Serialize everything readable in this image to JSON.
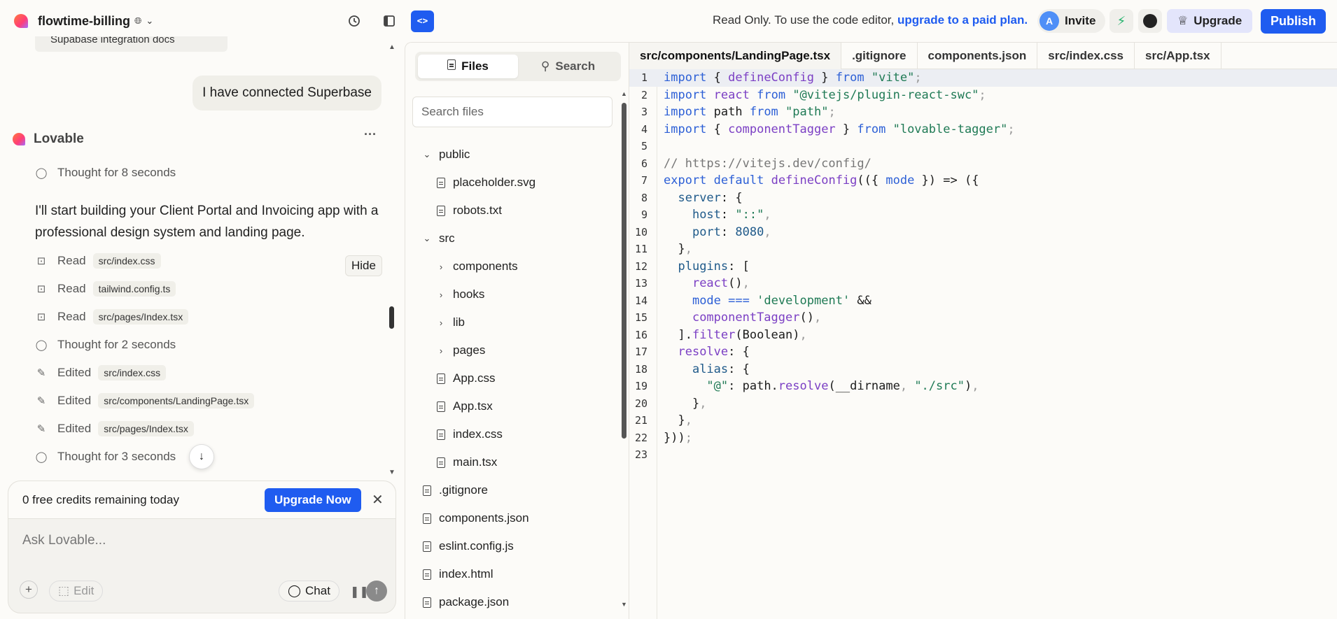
{
  "topbar": {
    "project_name": "flowtime-billing",
    "readonly_prefix": "Read Only. To use the code editor,",
    "readonly_link": "upgrade to a paid plan.",
    "avatar_letter": "A",
    "invite_label": "Invite",
    "upgrade_label": "Upgrade",
    "publish_label": "Publish",
    "code_toggle_label": "<>"
  },
  "chat": {
    "partial_chip": "Supabase integration docs",
    "user_message": "I have connected Superbase",
    "agent_name": "Lovable",
    "thought_1": "Thought for 8 seconds",
    "agent_text": "I'll start building your Client Portal and Invoicing app with a professional design system and landing page.",
    "hide_label": "Hide",
    "steps": [
      {
        "icon": "read-icon",
        "verb": "Read",
        "file": "src/index.css"
      },
      {
        "icon": "read-icon",
        "verb": "Read",
        "file": "tailwind.config.ts"
      },
      {
        "icon": "read-icon",
        "verb": "Read",
        "file": "src/pages/Index.tsx"
      },
      {
        "icon": "thought-icon",
        "verb": "Thought for 2 seconds",
        "file": ""
      },
      {
        "icon": "edit-icon",
        "verb": "Edited",
        "file": "src/index.css"
      },
      {
        "icon": "edit-icon",
        "verb": "Edited",
        "file": "src/components/LandingPage.tsx"
      },
      {
        "icon": "edit-icon",
        "verb": "Edited",
        "file": "src/pages/Index.tsx"
      },
      {
        "icon": "thought-icon",
        "verb": "Thought for 3 seconds",
        "file": ""
      }
    ],
    "credits_text": "0 free credits remaining today",
    "upgrade_now_label": "Upgrade Now",
    "input_placeholder": "Ask Lovable...",
    "edit_label": "Edit",
    "chat_label": "Chat"
  },
  "files": {
    "tab_files": "Files",
    "tab_search": "Search",
    "search_placeholder": "Search files",
    "tree": [
      {
        "name": "public",
        "type": "folder-open",
        "depth": 0
      },
      {
        "name": "placeholder.svg",
        "type": "file",
        "depth": 1
      },
      {
        "name": "robots.txt",
        "type": "file",
        "depth": 1
      },
      {
        "name": "src",
        "type": "folder-open",
        "depth": 0
      },
      {
        "name": "components",
        "type": "folder",
        "depth": 1
      },
      {
        "name": "hooks",
        "type": "folder",
        "depth": 1
      },
      {
        "name": "lib",
        "type": "folder",
        "depth": 1
      },
      {
        "name": "pages",
        "type": "folder",
        "depth": 1
      },
      {
        "name": "App.css",
        "type": "file",
        "depth": 1
      },
      {
        "name": "App.tsx",
        "type": "file",
        "depth": 1
      },
      {
        "name": "index.css",
        "type": "file",
        "depth": 1
      },
      {
        "name": "main.tsx",
        "type": "file",
        "depth": 1
      },
      {
        "name": ".gitignore",
        "type": "file",
        "depth": 0
      },
      {
        "name": "components.json",
        "type": "file",
        "depth": 0
      },
      {
        "name": "eslint.config.js",
        "type": "file",
        "depth": 0
      },
      {
        "name": "index.html",
        "type": "file",
        "depth": 0
      },
      {
        "name": "package.json",
        "type": "file",
        "depth": 0
      }
    ]
  },
  "editor": {
    "tabs": [
      "src/components/LandingPage.tsx",
      ".gitignore",
      "components.json",
      "src/index.css",
      "src/App.tsx"
    ],
    "active_tab": 0,
    "lines": [
      "import { defineConfig } from \"vite\";",
      "import react from \"@vitejs/plugin-react-swc\";",
      "import path from \"path\";",
      "import { componentTagger } from \"lovable-tagger\";",
      "",
      "// https://vitejs.dev/config/",
      "export default defineConfig(({ mode }) => ({",
      "  server: {",
      "    host: \"::\",",
      "    port: 8080,",
      "  },",
      "  plugins: [",
      "    react(),",
      "    mode === 'development' &&",
      "    componentTagger(),",
      "  ].filter(Boolean),",
      "  resolve: {",
      "    alias: {",
      "      \"@\": path.resolve(__dirname, \"./src\"),",
      "    },",
      "  },",
      "}));",
      ""
    ]
  }
}
